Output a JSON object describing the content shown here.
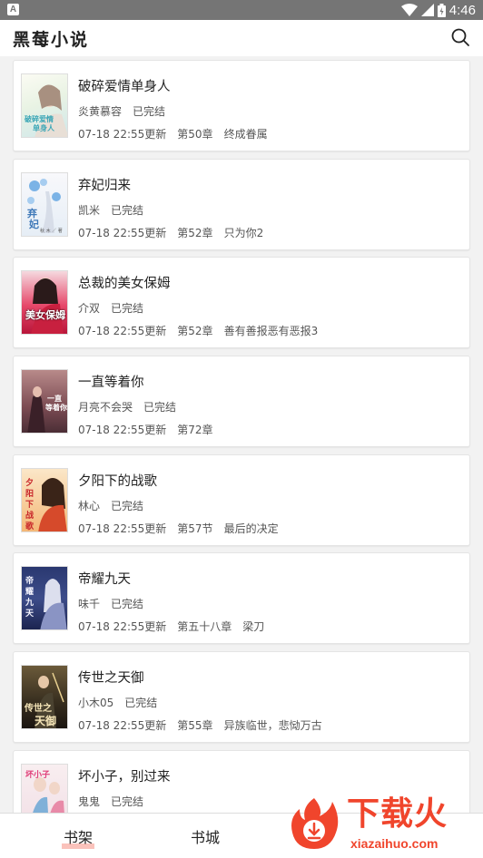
{
  "status_bar": {
    "time": "4:46"
  },
  "app_bar": {
    "title": "黑莓小说"
  },
  "books": [
    {
      "title": "破碎爱情单身人",
      "author": "炎黄慕容",
      "status": "已完结",
      "updated": "07-18 22:55更新",
      "chapter": "第50章",
      "chapter_title": "终成眷属",
      "cover_text": "破碎爱情单身人"
    },
    {
      "title": "弃妃归来",
      "author": "凯米",
      "status": "已完结",
      "updated": "07-18 22:55更新",
      "chapter": "第52章",
      "chapter_title": "只为你2",
      "cover_text": "弃妃归来"
    },
    {
      "title": "总裁的美女保姆",
      "author": "介双",
      "status": "已完结",
      "updated": "07-18 22:55更新",
      "chapter": "第52章",
      "chapter_title": "善有善报恶有恶报3",
      "cover_text": "美女保姆"
    },
    {
      "title": "一直等着你",
      "author": "月亮不会哭",
      "status": "已完结",
      "updated": "07-18 22:55更新",
      "chapter": "第72章",
      "chapter_title": "",
      "cover_text": "一直等着你"
    },
    {
      "title": "夕阳下的战歌",
      "author": "林心",
      "status": "已完结",
      "updated": "07-18 22:55更新",
      "chapter": "第57节",
      "chapter_title": "最后的决定",
      "cover_text": "夕阳下的战歌"
    },
    {
      "title": "帝耀九天",
      "author": "味千",
      "status": "已完结",
      "updated": "07-18 22:55更新",
      "chapter": "第五十八章",
      "chapter_title": "梁刀",
      "cover_text": "帝耀九天"
    },
    {
      "title": "传世之天御",
      "author": "小木05",
      "status": "已完结",
      "updated": "07-18 22:55更新",
      "chapter": "第55章",
      "chapter_title": "异族临世，悲恸万古",
      "cover_text": "传世之天御"
    },
    {
      "title": "坏小子，别过来",
      "author": "鬼鬼",
      "status": "已完结",
      "updated": "",
      "chapter": "",
      "chapter_title": "",
      "cover_text": "坏小子"
    }
  ],
  "bottom_nav": {
    "bookshelf": "书架",
    "bookstore": "书城"
  },
  "watermark": {
    "brand": "下载火",
    "url": "xiazaihuo.com"
  },
  "colors": {
    "accent": "#f0452c",
    "status_bar": "#757575"
  }
}
